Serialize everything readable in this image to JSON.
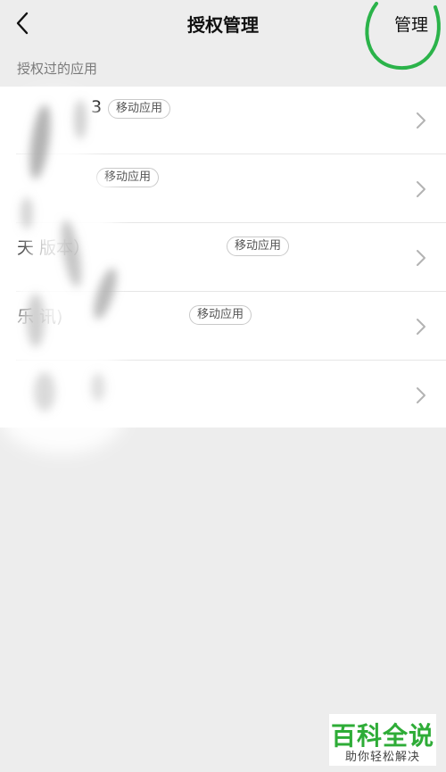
{
  "navbar": {
    "back_icon": "chevron-left-icon",
    "title": "授权管理",
    "action_label": "管理"
  },
  "section": {
    "label": "授权过的应用"
  },
  "apps": [
    {
      "name": "3",
      "subtitle": "",
      "badge": "移动应用"
    },
    {
      "name": "",
      "subtitle": "",
      "badge": "移动应用"
    },
    {
      "name": "天 版本）",
      "subtitle": "",
      "badge": "移动应用"
    },
    {
      "name": "乐 讯)",
      "subtitle": "",
      "badge": "移动应用"
    },
    {
      "name": "",
      "subtitle": "",
      "badge": ""
    }
  ],
  "watermark": {
    "title": "百科全说",
    "subtitle": "助你轻松解决"
  },
  "colors": {
    "background": "#ededed",
    "list_background": "#ffffff",
    "annotation_circle": "#2bb34a",
    "watermark_green": "#2eac37"
  }
}
